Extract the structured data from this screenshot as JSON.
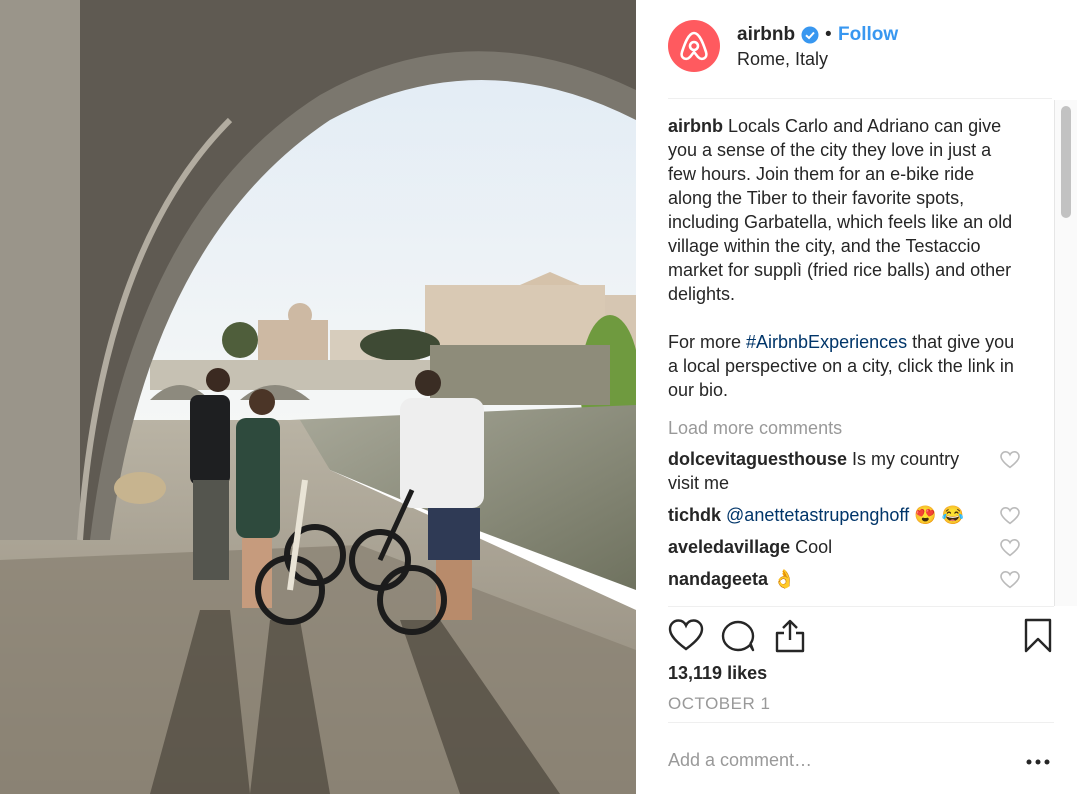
{
  "post": {
    "username": "airbnb",
    "separator": "•",
    "follow_label": "Follow",
    "location": "Rome, Italy",
    "caption_user": "airbnb",
    "caption_text": " Locals Carlo and Adriano can give you a sense of the city they love in just a few hours. Join them for an e-bike ride along the Tiber to their favorite spots, including Garbatella, which feels like an old village within the city, and the Testaccio market for supplì (fried rice balls) and other delights.",
    "caption_more_prefix": "For more ",
    "caption_hashtag": "#AirbnbExperiences",
    "caption_more_suffix": " that give you a local perspective on a city, click the link in our bio.",
    "load_more": "Load more comments",
    "comments": [
      {
        "user": "dolcevitaguesthouse",
        "text": " Is my country visit me"
      },
      {
        "user": "tichdk",
        "mention": "@anettetastrupenghoff",
        "text": " 😍 😂"
      },
      {
        "user": "aveledavillage",
        "text": " Cool"
      },
      {
        "user": "nandageeta",
        "text": " 👌"
      }
    ],
    "likes": "13,119 likes",
    "date": "OCTOBER 1",
    "comment_placeholder": "Add a comment…"
  },
  "colors": {
    "brand": "#ff5a5f",
    "link": "#3897f0",
    "hashtag": "#003569",
    "muted": "#999999"
  },
  "icons": [
    "airbnb-logo-icon",
    "verified-badge-icon",
    "heart-icon",
    "comment-icon",
    "share-icon",
    "bookmark-icon",
    "more-icon"
  ]
}
